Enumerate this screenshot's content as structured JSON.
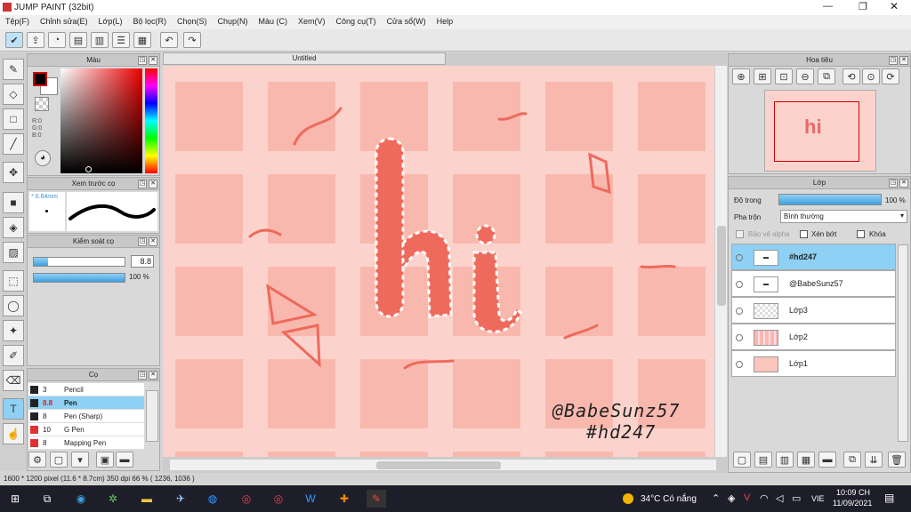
{
  "window": {
    "title": "JUMP PAINT (32bit)"
  },
  "menu": [
    "Tệp(F)",
    "Chỉnh sửa(E)",
    "Lớp(L)",
    "Bộ lọc(R)",
    "Chọn(S)",
    "Chụp(N)",
    "Màu (C)",
    "Xem(V)",
    "Công cụ(T)",
    "Cửa sổ(W)",
    "Help"
  ],
  "color_panel": {
    "title": "Màu",
    "r": "R:0",
    "g": "G:0",
    "b": "B:0"
  },
  "brush_preview": {
    "title": "Xem trước cọ",
    "size": "* 0.64mm"
  },
  "brush_control": {
    "title": "Kiểm soát cọ",
    "size": "8.8",
    "opacity": "100 %"
  },
  "brush_list": {
    "title": "Cọ",
    "items": [
      {
        "size": "3",
        "name": "Pencil",
        "color": "#222222"
      },
      {
        "size": "8.8",
        "name": "Pen",
        "color": "#222222",
        "selected": true
      },
      {
        "size": "8",
        "name": "Pen (Sharp)",
        "color": "#222222"
      },
      {
        "size": "10",
        "name": "G Pen",
        "color": "#e03030"
      },
      {
        "size": "8",
        "name": "Mapping Pen",
        "color": "#e03030"
      }
    ]
  },
  "document": {
    "tab": "Untitled"
  },
  "canvas_text": {
    "line1": "@BabeSunz57",
    "line2": "#hd247"
  },
  "navigator": {
    "title": "Hoa tiêu"
  },
  "layers": {
    "title": "Lớp",
    "opacity_label": "Độ trong",
    "opacity_value": "100 %",
    "blend_label": "Pha trộn",
    "blend_value": "Bình thường",
    "protect_alpha": "Bảo vệ alpha",
    "clipping": "Xén bớt",
    "lock": "Khóa",
    "items": [
      {
        "name": "#hd247",
        "selected": true
      },
      {
        "name": "@BabeSunz57"
      },
      {
        "name": "Lớp3"
      },
      {
        "name": "Lớp2"
      },
      {
        "name": "Lớp1"
      }
    ]
  },
  "status": {
    "text": "1600 * 1200 pixel  (11.6 * 8.7cm)  350 dpi  66 %  ( 1236, 1036 )"
  },
  "taskbar": {
    "weather": "34°C  Có nắng",
    "lang": "VIE",
    "time": "10:09 CH",
    "date": "11/09/2021"
  }
}
